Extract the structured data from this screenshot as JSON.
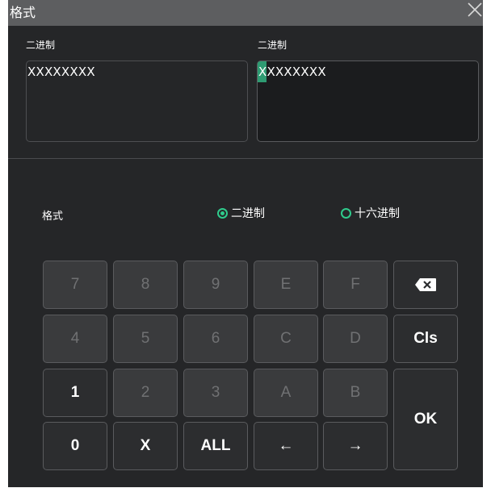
{
  "dialog": {
    "title": "格式"
  },
  "fields": {
    "left_label": "二进制",
    "left_value": "XXXXXXXX",
    "right_label": "二进制",
    "right_value": "XXXXXXXX"
  },
  "format": {
    "label": "格式",
    "options": [
      "二进制",
      "十六进制"
    ],
    "selected": "二进制"
  },
  "keypad": {
    "keys": [
      "7",
      "8",
      "9",
      "E",
      "F",
      "4",
      "5",
      "6",
      "C",
      "D",
      "Cls",
      "1",
      "2",
      "3",
      "A",
      "B",
      "OK",
      "0",
      "X",
      "ALL",
      "←",
      "→"
    ],
    "backspace_icon": "backspace-icon"
  },
  "colors": {
    "accent": "#2fcb8c",
    "cursor": "#2e9b72"
  }
}
